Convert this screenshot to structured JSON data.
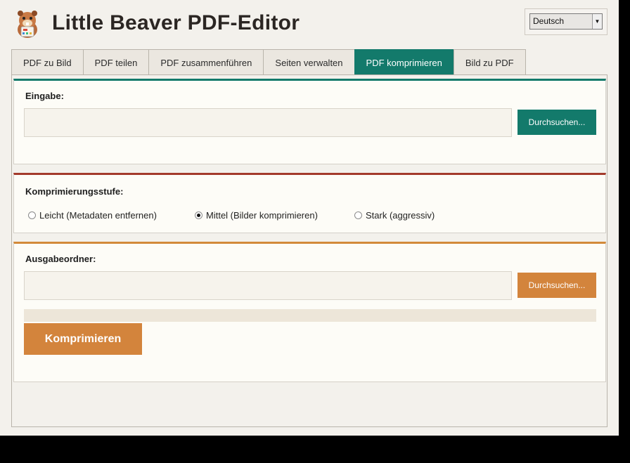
{
  "header": {
    "title": "Little Beaver PDF-Editor",
    "logo_icon": "beaver-logo-icon"
  },
  "language": {
    "selected": "Deutsch",
    "arrow": "▼"
  },
  "tabs": [
    {
      "label": "PDF zu Bild",
      "active": false
    },
    {
      "label": "PDF teilen",
      "active": false
    },
    {
      "label": "PDF zusammenführen",
      "active": false
    },
    {
      "label": "Seiten verwalten",
      "active": false
    },
    {
      "label": "PDF komprimieren",
      "active": true
    },
    {
      "label": "Bild zu PDF",
      "active": false
    }
  ],
  "input": {
    "label": "Eingabe:",
    "value": "",
    "browse_label": "Durchsuchen..."
  },
  "level": {
    "label": "Komprimierungsstufe:",
    "options": [
      {
        "label": "Leicht (Metadaten entfernen)",
        "checked": false
      },
      {
        "label": "Mittel (Bilder komprimieren)",
        "checked": true
      },
      {
        "label": "Stark (aggressiv)",
        "checked": false
      }
    ]
  },
  "output": {
    "label": "Ausgabeordner:",
    "value": "",
    "browse_label": "Durchsuchen...",
    "progress": 0,
    "action_label": "Komprimieren"
  },
  "colors": {
    "teal": "#137a6b",
    "red": "#a33a2b",
    "orange": "#d3843c",
    "background": "#f3f1ec"
  }
}
